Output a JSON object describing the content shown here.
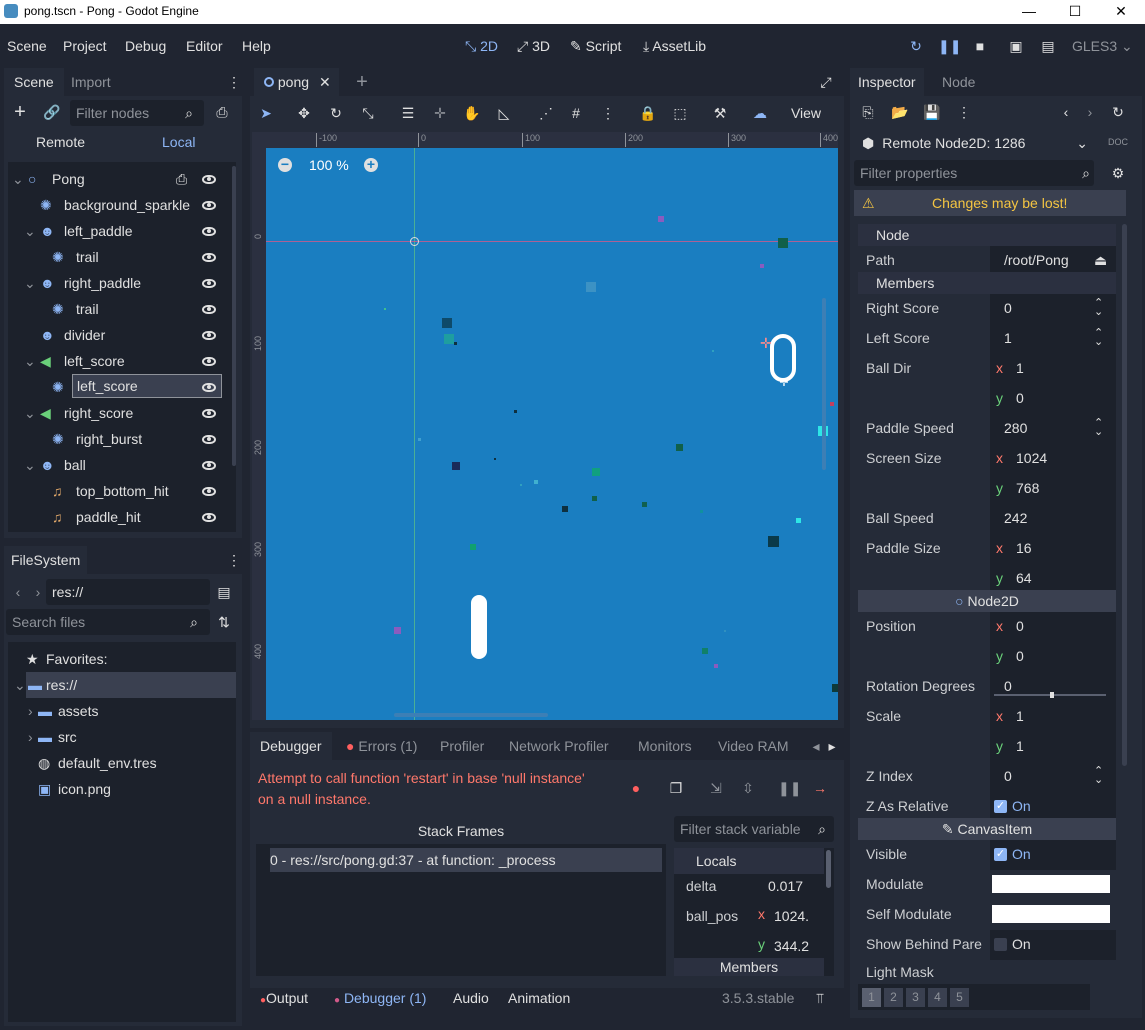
{
  "window": {
    "title": "pong.tscn - Pong - Godot Engine"
  },
  "menu": [
    "Scene",
    "Project",
    "Debug",
    "Editor",
    "Help"
  ],
  "modes": [
    {
      "label": "2D",
      "active": true
    },
    {
      "label": "3D"
    },
    {
      "label": "Script"
    },
    {
      "label": "AssetLib"
    }
  ],
  "renderer": "GLES3",
  "scene_dock": {
    "tabs": [
      "Scene",
      "Import"
    ],
    "filter_placeholder": "Filter nodes",
    "remote_label": "Remote",
    "local_label": "Local",
    "nodes": [
      {
        "name": "Pong",
        "depth": 0,
        "icon": "node2d-icon",
        "script": true
      },
      {
        "name": "background_sparkle",
        "depth": 1,
        "icon": "particles-icon"
      },
      {
        "name": "left_paddle",
        "depth": 1,
        "icon": "sprite-icon"
      },
      {
        "name": "trail",
        "depth": 2,
        "icon": "particles-icon"
      },
      {
        "name": "right_paddle",
        "depth": 1,
        "icon": "sprite-icon"
      },
      {
        "name": "trail",
        "depth": 2,
        "icon": "particles-icon"
      },
      {
        "name": "divider",
        "depth": 1,
        "icon": "sprite-icon"
      },
      {
        "name": "left_score",
        "depth": 1,
        "icon": "label-icon"
      },
      {
        "name": "left_score",
        "depth": 2,
        "icon": "particles-icon",
        "selected": true
      },
      {
        "name": "right_score",
        "depth": 1,
        "icon": "label-icon"
      },
      {
        "name": "right_burst",
        "depth": 2,
        "icon": "particles-icon"
      },
      {
        "name": "ball",
        "depth": 1,
        "icon": "sprite-icon"
      },
      {
        "name": "top_bottom_hit",
        "depth": 2,
        "icon": "audio-icon"
      },
      {
        "name": "paddle_hit",
        "depth": 2,
        "icon": "audio-icon"
      }
    ]
  },
  "filesystem": {
    "title": "FileSystem",
    "path": "res://",
    "search_placeholder": "Search files",
    "items": [
      {
        "label": "Favorites:",
        "depth": 0
      },
      {
        "label": "res://",
        "depth": 0,
        "selected": true
      },
      {
        "label": "assets",
        "depth": 1
      },
      {
        "label": "src",
        "depth": 1
      },
      {
        "label": "default_env.tres",
        "depth": 1
      },
      {
        "label": "icon.png",
        "depth": 1
      }
    ]
  },
  "viewport": {
    "tab": "pong",
    "view_label": "View",
    "zoom": "100 %",
    "score": "0",
    "ruler_top": [
      "-100",
      "0",
      "100",
      "200",
      "300",
      "400"
    ],
    "ruler_left": [
      "0",
      "100",
      "200",
      "300",
      "400"
    ]
  },
  "debugger": {
    "tabs": [
      "Debugger",
      "Errors (1)",
      "Profiler",
      "Network Profiler",
      "Monitors",
      "Video RAM"
    ],
    "error": "Attempt to call function 'restart' in base 'null instance' on a null instance.",
    "stack_header": "Stack Frames",
    "stack": [
      "0 - res://src/pong.gd:37 - at function: _process"
    ],
    "filter_placeholder": "Filter stack variable",
    "locals_label": "Locals",
    "locals": [
      {
        "name": "delta",
        "value": "0.017"
      },
      {
        "name": "ball_pos",
        "x": "1024.",
        "y": "344.2"
      }
    ],
    "members_label": "Members"
  },
  "bottom": {
    "tabs": [
      "Output",
      "Debugger (1)",
      "Audio",
      "Animation"
    ],
    "version": "3.5.3.stable"
  },
  "inspector": {
    "tabs": [
      "Inspector",
      "Node"
    ],
    "object": "Remote Node2D: 1286",
    "filter_placeholder": "Filter properties",
    "warning": "Changes may be lost!",
    "node_section": "Node",
    "path_label": "Path",
    "path_value": "/root/Pong",
    "members_section": "Members",
    "right_score": {
      "label": "Right Score",
      "value": "0"
    },
    "left_score": {
      "label": "Left Score",
      "value": "1"
    },
    "ball_dir": {
      "label": "Ball Dir",
      "x": "1",
      "y": "0"
    },
    "paddle_speed": {
      "label": "Paddle Speed",
      "value": "280"
    },
    "screen_size": {
      "label": "Screen Size",
      "x": "1024",
      "y": "768"
    },
    "ball_speed": {
      "label": "Ball Speed",
      "value": "242"
    },
    "paddle_size": {
      "label": "Paddle Size",
      "x": "16",
      "y": "64"
    },
    "node2d_section": "Node2D",
    "position": {
      "label": "Position",
      "x": "0",
      "y": "0"
    },
    "rotation": {
      "label": "Rotation Degrees",
      "value": "0"
    },
    "scale": {
      "label": "Scale",
      "x": "1",
      "y": "1"
    },
    "z_index": {
      "label": "Z Index",
      "value": "0"
    },
    "z_relative": {
      "label": "Z As Relative",
      "value": "On"
    },
    "canvas_section": "CanvasItem",
    "visible": {
      "label": "Visible",
      "value": "On"
    },
    "modulate": {
      "label": "Modulate"
    },
    "self_modulate": {
      "label": "Self Modulate"
    },
    "show_behind": {
      "label": "Show Behind Pare",
      "value": "On"
    },
    "light_mask": {
      "label": "Light Mask",
      "bits": [
        "1",
        "2",
        "3",
        "4",
        "5"
      ]
    }
  },
  "colors": {
    "accent": "#8eb6f5",
    "viewport_bg": "#1a7ec1",
    "error": "#ff786b",
    "warning": "#f5c542"
  }
}
